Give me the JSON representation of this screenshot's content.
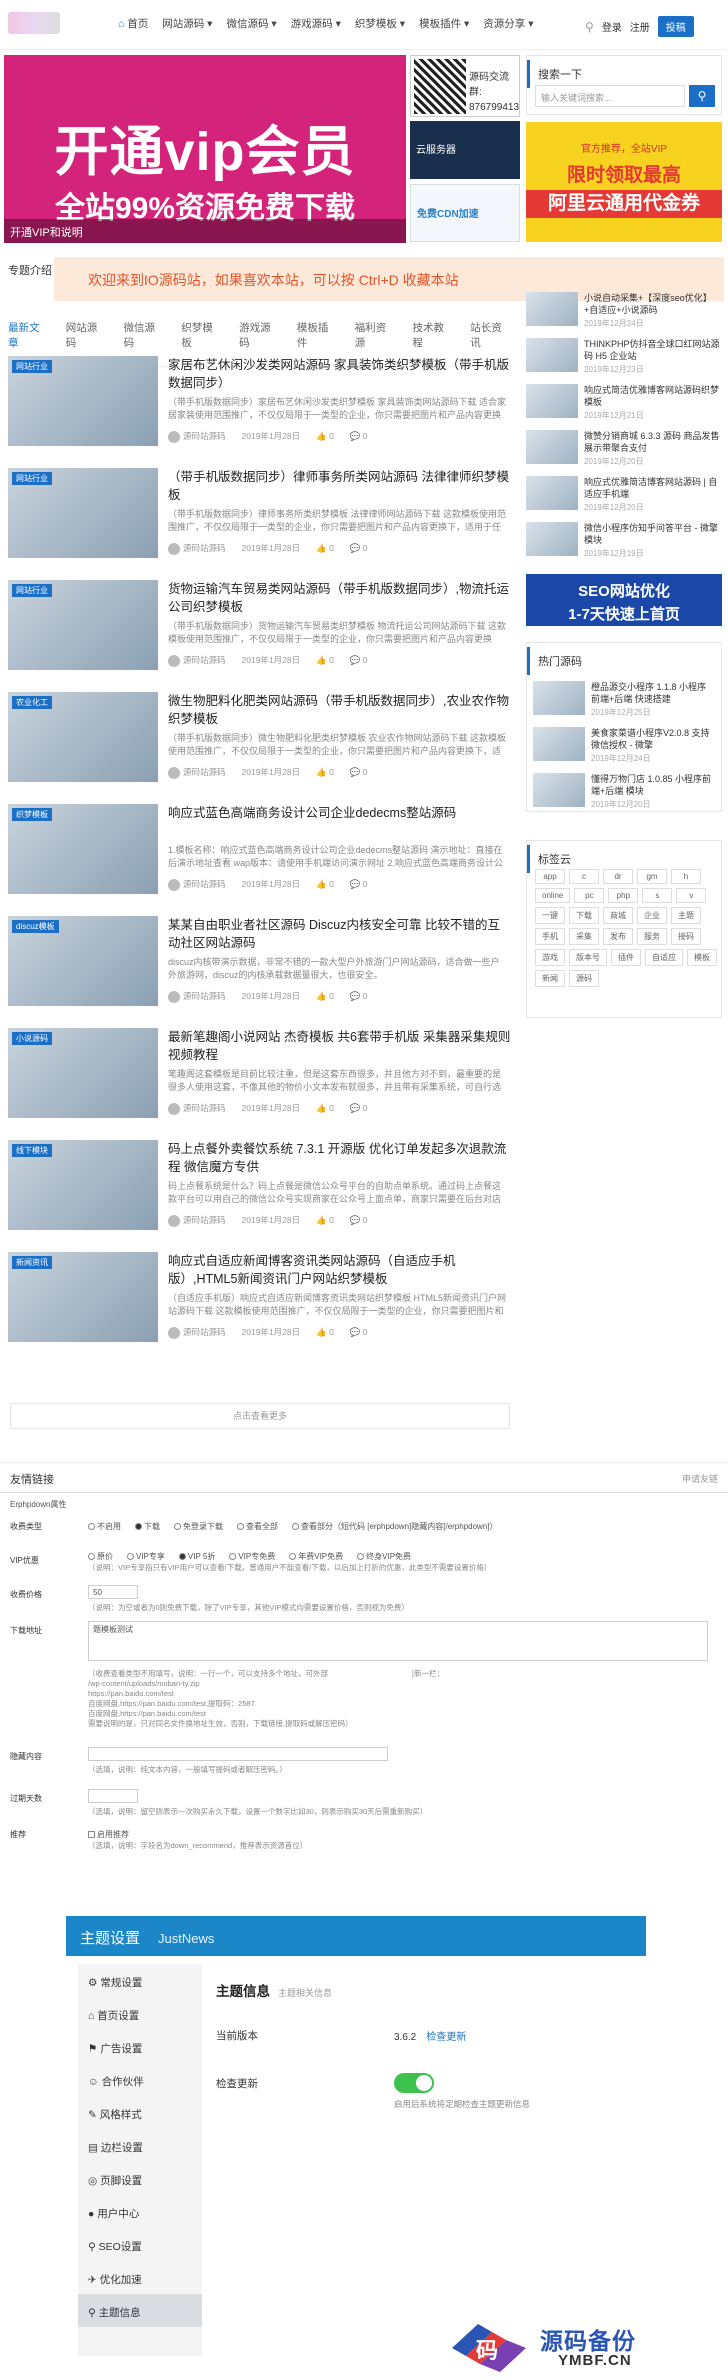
{
  "nav": {
    "items": [
      "首页",
      "网站源码",
      "微信源码",
      "游戏源码",
      "织梦模板",
      "模板插件",
      "资源分享"
    ],
    "login": "登录",
    "register": "注册",
    "submit": "投稿"
  },
  "hero": {
    "line1": "开通vip会员",
    "line2": "全站99%资源免费下载",
    "caption": "开通VIP和说明"
  },
  "ads": {
    "qr_text1": "源码交流群:",
    "qr_text2": "876799413",
    "ad2": "云服务器",
    "ad3": "免费CDN加速"
  },
  "sidebar": {
    "search_title": "搜索一下",
    "search_placeholder": "输入关键词搜索...",
    "orange_ad_a": "官方推荐，全站VIP",
    "orange_ad_b": "限时领取最高",
    "orange_ad_c": "阿里云通用代金券",
    "new_items": [
      {
        "title": "小说自动采集+【深度seo优化】+自适应+小说源码",
        "date": "2019年12月24日"
      },
      {
        "title": "THINKPHP仿抖音全球口红网站源码 H5 企业站",
        "date": "2019年12月23日"
      },
      {
        "title": "响应式简洁优雅博客网站源码织梦模板",
        "date": "2019年12月21日"
      },
      {
        "title": "微赞分销商城 6.3.3 源码 商品发售展示带聚合支付",
        "date": "2019年12月20日"
      },
      {
        "title": "响应式优雅简洁博客网站源码 | 自适应手机端",
        "date": "2019年12月20日"
      },
      {
        "title": "微信小程序仿知乎问答平台 - 微擎模块",
        "date": "2019年12月19日"
      }
    ],
    "seo_line1": "SEO网站优化",
    "seo_line2": "1-7天快速上首页",
    "hot_title": "热门源码",
    "hot_items": [
      {
        "title": "橙品源交小程序 1.1.8 小程序前端+后端 快速搭建",
        "date": "2019年12月25日"
      },
      {
        "title": "美食家菜谱小程序V2.0.8 支持微信授权 - 微擎",
        "date": "2019年12月24日"
      },
      {
        "title": "懂得万物门店 1.0.85 小程序前端+后端 模块",
        "date": "2019年12月20日"
      }
    ],
    "tag_title": "标签云",
    "tags": [
      "app",
      "c",
      "dr",
      "gm",
      "h",
      "online",
      "pc",
      "php",
      "s",
      "v",
      "一键",
      "下载",
      "商城",
      "企业",
      "主题",
      "手机",
      "采集",
      "发布",
      "服务",
      "接码",
      "游戏",
      "版本号",
      "插件",
      "自适应",
      "模板",
      "新闻",
      "源码"
    ]
  },
  "welcome": "欢迎来到IO源码站，如果喜欢本站，可以按 Ctrl+D 收藏本站",
  "special": "专题介绍",
  "tabs": [
    "最新文章",
    "网站源码",
    "微信源码",
    "织梦模板",
    "游戏源码",
    "模板插件",
    "福利资源",
    "技术教程",
    "站长资讯"
  ],
  "articles": [
    {
      "tag": "网站行业",
      "title": "家居布艺休闲沙发类网站源码 家具装饰类织梦模板（带手机版数据同步）",
      "desc": "（带手机版数据同步）家居布艺休闲沙发类织梦模板 家具装饰类网站源码下载 适合家居家装使用范围推广，不仅仅局限于一类型的企业，你只需要把图片和产品内容更换下，适用于任何企业。",
      "author": "源码站源码",
      "date": "2019年1月28日",
      "likes": "0",
      "comments": "0"
    },
    {
      "tag": "网站行业",
      "title": "（带手机版数据同步）律师事务所类网站源码 法律律师织梦模板",
      "desc": "（带手机版数据同步）律师事务所类织梦模板 法律律师网站源码下载 这款模板使用范围推广，不仅仅局限于一类型的企业，你只需要把图片和产品内容更换下，适用于任何企业。",
      "author": "源码站源码",
      "date": "2019年1月28日",
      "likes": "0",
      "comments": "0"
    },
    {
      "tag": "网站行业",
      "title": "货物运输汽车贸易类网站源码（带手机版数据同步）,物流托运公司织梦模板",
      "desc": "（带手机版数据同步）货物运输汽车贸易类织梦模板 物流托运公司网站源码下载 这款模板使用范围推广，不仅仅局限于一类型的企业，你只需要把图片和产品内容更换下，适用于。",
      "author": "源码站源码",
      "date": "2019年1月28日",
      "likes": "0",
      "comments": "0"
    },
    {
      "tag": "农业化工",
      "title": "微生物肥料化肥类网站源码（带手机版数据同步）,农业农作物织梦模板",
      "desc": "（带手机版数据同步）微生物肥料化肥类织梦模板 农业农作物网站源码下载 这款模板使用范围推广，不仅仅局限于一类型的企业，你只需要把图片和产品内容更换下，适用于任何企业。",
      "author": "源码站源码",
      "date": "2019年1月28日",
      "likes": "0",
      "comments": "0"
    },
    {
      "tag": "织梦模板",
      "title": "响应式蓝色高端商务设计公司企业dedecms整站源码",
      "desc": "1.模板名称：响应式蓝色高端商务设计公司企业dedecms整站源码 演示地址：直接在后演示地址查看 wap版本：请使用手机端访问演示网址 2.响应式蓝色高端商务设计公司企业dedecms。",
      "author": "源码站源码",
      "date": "2019年1月28日",
      "likes": "0",
      "comments": "0"
    },
    {
      "tag": "discuz模板",
      "title": "某某自由职业者社区源码 Discuz内核安全可靠 比较不错的互动社区网站源码",
      "desc": "discuz内核带演示数据，非常不错的一款大型户外旅游门户网站源码，适合做一些户外旅游网，discuz的内核承载数据量很大，也很安全。",
      "author": "源码站源码",
      "date": "2019年1月28日",
      "likes": "0",
      "comments": "0"
    },
    {
      "tag": "小说源码",
      "title": "最新笔趣阁小说网站 杰奇模板 共6套带手机版 采集器采集规则视频教程",
      "desc": "笔趣阁这套模板是目前比较注重，但是这套东西很多，并且他方对不到，最重要的是很多人使用这套，不像其他的物价小文本发布就很多，并且带有采集系统，可自行选择。",
      "author": "源码站源码",
      "date": "2019年1月28日",
      "likes": "0",
      "comments": "0"
    },
    {
      "tag": "线下模块",
      "title": "码上点餐外卖餐饮系统 7.3.1 开源版 优化订单发起多次退款流程 微信魔方专供",
      "desc": "码上点餐系统是什么？码上点餐是微信公众号平台的自助点单系统。通过码上点餐这款平台可以用自己的微信公众号实现商家在公众号上面点单，商家只需要在后台对店铺进行设置即可使用。",
      "author": "源码站源码",
      "date": "2019年1月28日",
      "likes": "0",
      "comments": "0"
    },
    {
      "tag": "新闻资讯",
      "title": "响应式自适应新闻博客资讯类网站源码（自适应手机版）,HTML5新闻资讯门户网站织梦模板",
      "desc": "（自适应手机版）响应式自适应新闻博客资讯类网站织梦模板 HTML5新闻资讯门户网站源码下载 这款模板使用范围推广，不仅仅局限于一类型的企业，你只需要把图片和产品内容更换下。",
      "author": "源码站源码",
      "date": "2019年1月28日",
      "likes": "0",
      "comments": "0"
    }
  ],
  "more": "点击查看更多",
  "friend": {
    "title": "友情链接",
    "right": "申请友链"
  },
  "form": {
    "header": "Erphpdown属性",
    "type_label": "收费类型",
    "type_options": [
      "不启用",
      "下载",
      "免登录下载",
      "查看全部",
      "查看部分（短代码 [erphpdown]隐藏内容[/erphpdown]）"
    ],
    "type_selected": 1,
    "vip_label": "VIP优惠",
    "vip_options": [
      "原价",
      "VIP专享",
      "VIP 5折",
      "VIP专免费",
      "年费VIP免费",
      "终身VIP免费"
    ],
    "vip_selected": 2,
    "vip_note": "（说明：VIP专享指只有VIP用户可以查看/下载，普通用户不能查看/下载，以后加上打折的优惠，此类型不需要设置价格）",
    "price_label": "收费价格",
    "price_value": "50",
    "price_note": "（说明：为空或者为0则免费下载，除了VIP专享，其他VIP模式均需要设置价格，否则视为免费）",
    "url_label": "下载地址",
    "url_value": "题模板测试",
    "url_notes": [
      "（收费查看类型不用填写，说明：一行一个，可以支持多个地址，可外部",
      "/wp-content/uploads/moban-ty.zip",
      "https://pan.baidu.com/test",
      "百度网盘,https://pan.baidu.com/test,提取码：2587",
      "百度网盘,https://pan.baidu.com/test",
      "需要说明的是，只对同名文件换地址生效，否则，下载链接,提取码或解压密码）"
    ],
    "url_note_right": "[新一栏：",
    "hidden_label": "隐藏内容",
    "hidden_note": "（选填，说明：纯文本内容，一般填写提码或者解压密码。）",
    "expire_label": "过期天数",
    "expire_note": "（选填，说明：留空则表示一次购买永久下载，设置一个数字比如30，则表示购买30天后需重新购买）",
    "rec_label": "推荐",
    "rec_option": "启用推荐",
    "rec_note": "（选填，说明：字段名为down_recommend，推荐表示资源首位）"
  },
  "theme": {
    "title": "主题设置",
    "name": "JustNews",
    "menu": [
      "常规设置",
      "首页设置",
      "广告设置",
      "合作伙伴",
      "风格样式",
      "边栏设置",
      "页脚设置",
      "用户中心",
      "SEO设置",
      "优化加速",
      "主题信息"
    ],
    "active": 10,
    "section": "主题信息",
    "section_sub": "主题相关信息",
    "version_label": "当前版本",
    "version": "3.6.2",
    "check_link": "检查更新",
    "update_label": "检查更新",
    "update_note": "启用后系统将定期检查主题更新信息"
  },
  "watermark": {
    "cn": "源码备份",
    "en": "YMBF.CN"
  }
}
